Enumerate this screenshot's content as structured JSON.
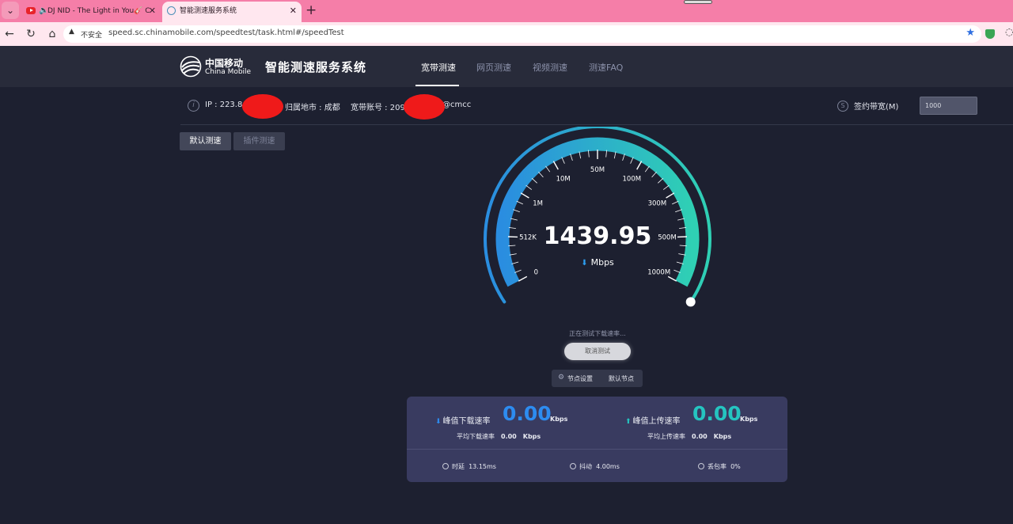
{
  "browser": {
    "tabs": [
      {
        "title": "DJ NID - The Light in You🎸 C",
        "active": false
      },
      {
        "title": "智能测速服务系统",
        "active": true
      }
    ],
    "address": {
      "security": "不安全",
      "url": "speed.sc.chinamobile.com/speedtest/task.html#/speedTest"
    }
  },
  "header": {
    "logo_cn": "中国移动",
    "logo_en": "China Mobile",
    "title": "智能测速服务系统",
    "nav": [
      "宽带测速",
      "网页测速",
      "视频测速",
      "测速FAQ"
    ],
    "active_nav": "宽带测速"
  },
  "info": {
    "ip_label": "IP : 223.8",
    "city_label": "归属地市 : 成都",
    "account_label": "宽带账号 : 209",
    "account_suffix": "@cmcc",
    "bandwidth_label": "签约带宽(M)",
    "bandwidth_value": "1000"
  },
  "modes": {
    "default": "默认测速",
    "plugin": "插件测速"
  },
  "gauge": {
    "ticks": [
      "0",
      "512K",
      "1M",
      "10M",
      "50M",
      "100M",
      "300M",
      "500M",
      "1000M"
    ],
    "value": "1439.95",
    "unit": "Mbps",
    "fill_fraction": 1.0,
    "colors": {
      "start": "#2a8de0",
      "end": "#2fd0b4",
      "track": "#2b2f42"
    }
  },
  "status": {
    "text": "正在测试下载速率...",
    "cancel": "取消测试",
    "node_settings": "节点设置",
    "default_node": "默认节点"
  },
  "stats": {
    "peak_download_label": "峰值下载速率",
    "peak_download_value": "0.00",
    "peak_upload_label": "峰值上传速率",
    "peak_upload_value": "0.00",
    "unit": "Kbps",
    "avg_download_label": "平均下载速率",
    "avg_download_value": "0.00",
    "avg_upload_label": "平均上传速率",
    "avg_upload_value": "0.00",
    "latency_label": "时延",
    "latency_value": "13.15ms",
    "jitter_label": "抖动",
    "jitter_value": "4.00ms",
    "loss_label": "丢包率",
    "loss_value": "0%",
    "colors": {
      "download": "#2d8cf0",
      "upload": "#25c4c0"
    }
  }
}
